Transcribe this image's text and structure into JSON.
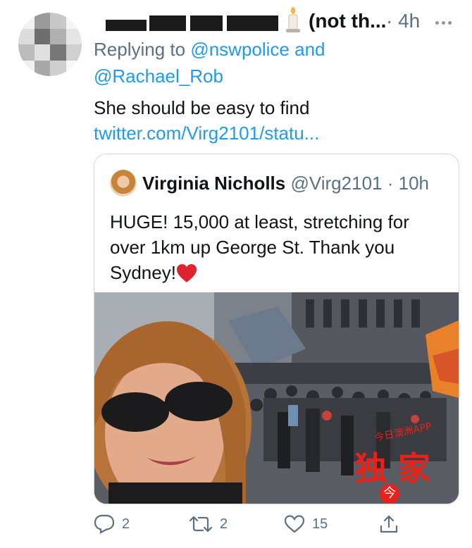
{
  "tweet": {
    "author_suffix": "(not th...",
    "time": "4h",
    "replying_prefix": "Replying to",
    "replying_handle1": "@nswpolice",
    "replying_and": "and",
    "replying_handle2": "@Rachael_Rob",
    "text": "She should be easy to find",
    "link": "twitter.com/Virg2101/statu..."
  },
  "quote": {
    "name": "Virginia Nicholls",
    "handle": "@Virg2101",
    "time": "10h",
    "lines": [
      "HUGE! 15,000 at least, stretching for",
      "over 1km up George St. Thank you",
      "Sydney!"
    ]
  },
  "watermark": {
    "arc_text": "今日澳洲APP",
    "main_text": "独 家",
    "badge": "今",
    "color": "#e8221a"
  },
  "actions": {
    "reply_count": "2",
    "retweet_count": "2",
    "like_count": "15"
  },
  "colors": {
    "link": "#1d9bf0",
    "muted": "#5b7083",
    "border": "#cfd9de"
  }
}
